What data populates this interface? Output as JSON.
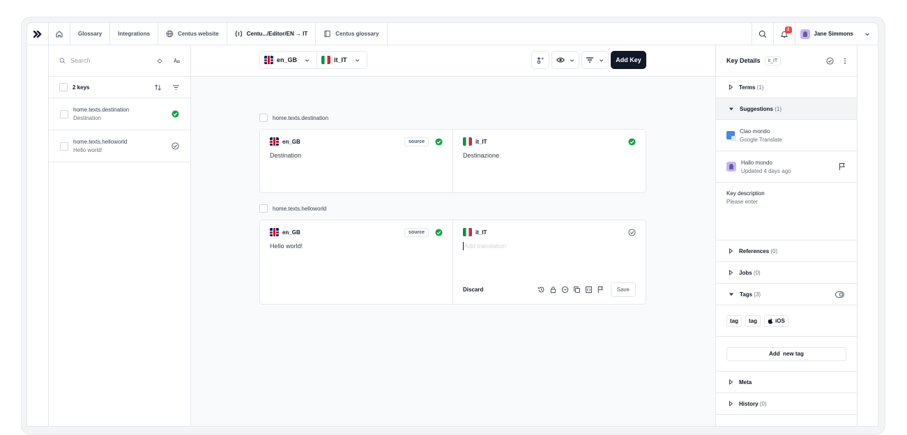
{
  "topbar": {
    "tabs": [
      {
        "label": "Glossary"
      },
      {
        "label": "Integrations"
      },
      {
        "label": "Centus website"
      },
      {
        "label": "Centu.../Editor/EN → IT"
      },
      {
        "label": "Centus glossary"
      }
    ],
    "notification_count": "2",
    "user_name": "Jane Simmons"
  },
  "keys_panel": {
    "search_placeholder": "Search",
    "count_label": "2 keys",
    "items": [
      {
        "key": "home.texts.destination",
        "value": "Destination"
      },
      {
        "key": "home.texts.helloworld",
        "value": "Hello world!"
      }
    ]
  },
  "editor": {
    "source_lang": "en_GB",
    "target_lang": "it_IT",
    "add_key_label": "Add Key",
    "source_badge": "source",
    "entries": [
      {
        "key": "home.texts.destination",
        "source_text": "Destination",
        "target_text": "Destinazione"
      },
      {
        "key": "home.texts.helloworld",
        "source_text": "Hello world!",
        "target_placeholder": "Add translation"
      }
    ],
    "discard_label": "Discard",
    "save_label": "Save"
  },
  "details": {
    "title": "Key Details",
    "locale": "it_IT",
    "terms": {
      "label": "Terms",
      "count": "(1)"
    },
    "suggestions": {
      "label": "Suggestions",
      "count": "(1)"
    },
    "suggestion_items": [
      {
        "text": "Ciao mondo",
        "source": "Google Translate"
      },
      {
        "text": "Hallo mondo",
        "source": "Updated 4 days ago"
      }
    ],
    "description": {
      "label": "Key description",
      "placeholder": "Please enter"
    },
    "references": {
      "label": "References",
      "count": "(0)"
    },
    "jobs": {
      "label": "Jobs",
      "count": "(0)"
    },
    "tags_section": {
      "label": "Tags",
      "count": "(3)"
    },
    "tags": [
      "tag",
      "tag",
      "iOS"
    ],
    "add_tag_label": "Add  new tag",
    "meta": {
      "label": "Meta"
    },
    "history": {
      "label": "History",
      "count": "(0)"
    }
  },
  "colors": {
    "accent": "#111827",
    "success": "#16a34a",
    "badge": "#ef4444"
  }
}
